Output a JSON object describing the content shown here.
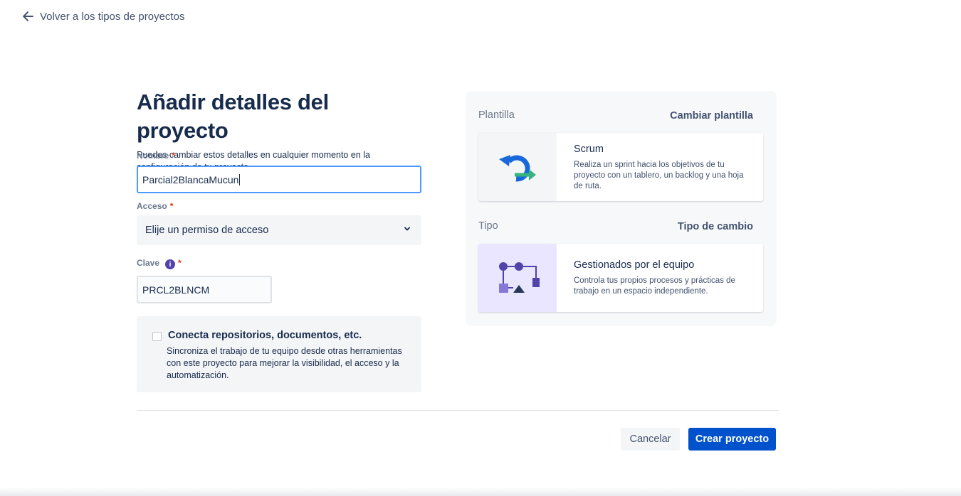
{
  "back_link": {
    "label": "Volver a los tipos de proyectos",
    "icon": "arrow-left-icon"
  },
  "form": {
    "title": "Añadir detalles del proyecto",
    "subtitle": "Puedes cambiar estos detalles en cualquier momento en la configuración de tu proyecto.",
    "required_marker": "*",
    "nombre": {
      "label": "Nombre",
      "value": "Parcial2BlancaMucun"
    },
    "acceso": {
      "label": "Acceso",
      "value": "Elije un permiso de acceso",
      "icon": "chevron-down-icon"
    },
    "clave": {
      "label": "Clave",
      "info_glyph": "i",
      "value": "PRCL2BLNCM"
    },
    "connect": {
      "title": "Conecta repositorios, documentos, etc.",
      "description": "Sincroniza el trabajo de tu equipo desde otras herramientas con este proyecto para mejorar la visibilidad, el acceso y la automatización.",
      "checked": false
    }
  },
  "panel": {
    "plantilla_label": "Plantilla",
    "plantilla_link": "Cambiar plantilla",
    "template_card": {
      "title": "Scrum",
      "description": "Realiza un sprint hacia los objetivos de tu proyecto con un tablero, un backlog y una hoja de ruta.",
      "icon": "scrum-cycle-icon"
    },
    "tipo_label": "Tipo",
    "tipo_link": "Tipo de cambio",
    "type_card": {
      "title": "Gestionados por el equipo",
      "description": "Controla tus propios procesos y prácticas de trabajo en un espacio independiente.",
      "icon": "team-managed-icon"
    }
  },
  "actions": {
    "cancel": "Cancelar",
    "create": "Crear proyecto"
  },
  "colors": {
    "primary": "#0052cc",
    "focus": "#4c9aff",
    "required": "#de350b",
    "text": "#172b4d"
  }
}
